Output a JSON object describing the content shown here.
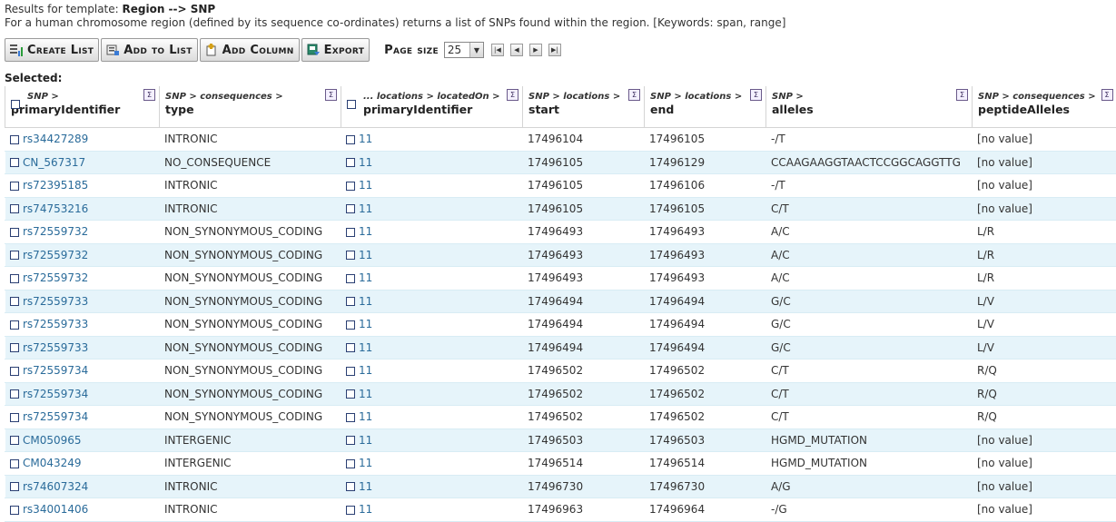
{
  "header": {
    "results_prefix": "Results for template:",
    "template_name": "Region --> SNP",
    "description": "For a human chromosome region (defined by its sequence co-ordinates) returns a list of SNPs found within the region. [Keywords: span, range]"
  },
  "toolbar": {
    "create_list": "Create List",
    "add_to_list": "Add to List",
    "add_column": "Add Column",
    "export": "Export",
    "page_size_label": "Page size",
    "page_size_value": "25"
  },
  "selected_label": "Selected:",
  "columns": [
    {
      "path": "SNP >",
      "field": "primaryIdentifier"
    },
    {
      "path": "SNP > consequences >",
      "field": "type"
    },
    {
      "path": "... locations > locatedOn >",
      "field": "primaryIdentifier"
    },
    {
      "path": "SNP > locations >",
      "field": "start"
    },
    {
      "path": "SNP > locations >",
      "field": "end"
    },
    {
      "path": "SNP >",
      "field": "alleles"
    },
    {
      "path": "SNP > consequences >",
      "field": "peptideAlleles"
    }
  ],
  "sigma": "Σ",
  "rows": [
    {
      "id": "rs34427289",
      "type": "INTRONIC",
      "chr": "11",
      "start": "17496104",
      "end": "17496105",
      "alleles": "-/T",
      "pep": "[no value]"
    },
    {
      "id": "CN_567317",
      "type": "NO_CONSEQUENCE",
      "chr": "11",
      "start": "17496105",
      "end": "17496129",
      "alleles": "CCAAGAAGGTAACTCCGGCAGGTTG",
      "pep": "[no value]"
    },
    {
      "id": "rs72395185",
      "type": "INTRONIC",
      "chr": "11",
      "start": "17496105",
      "end": "17496106",
      "alleles": "-/T",
      "pep": "[no value]"
    },
    {
      "id": "rs74753216",
      "type": "INTRONIC",
      "chr": "11",
      "start": "17496105",
      "end": "17496105",
      "alleles": "C/T",
      "pep": "[no value]"
    },
    {
      "id": "rs72559732",
      "type": "NON_SYNONYMOUS_CODING",
      "chr": "11",
      "start": "17496493",
      "end": "17496493",
      "alleles": "A/C",
      "pep": "L/R"
    },
    {
      "id": "rs72559732",
      "type": "NON_SYNONYMOUS_CODING",
      "chr": "11",
      "start": "17496493",
      "end": "17496493",
      "alleles": "A/C",
      "pep": "L/R"
    },
    {
      "id": "rs72559732",
      "type": "NON_SYNONYMOUS_CODING",
      "chr": "11",
      "start": "17496493",
      "end": "17496493",
      "alleles": "A/C",
      "pep": "L/R"
    },
    {
      "id": "rs72559733",
      "type": "NON_SYNONYMOUS_CODING",
      "chr": "11",
      "start": "17496494",
      "end": "17496494",
      "alleles": "G/C",
      "pep": "L/V"
    },
    {
      "id": "rs72559733",
      "type": "NON_SYNONYMOUS_CODING",
      "chr": "11",
      "start": "17496494",
      "end": "17496494",
      "alleles": "G/C",
      "pep": "L/V"
    },
    {
      "id": "rs72559733",
      "type": "NON_SYNONYMOUS_CODING",
      "chr": "11",
      "start": "17496494",
      "end": "17496494",
      "alleles": "G/C",
      "pep": "L/V"
    },
    {
      "id": "rs72559734",
      "type": "NON_SYNONYMOUS_CODING",
      "chr": "11",
      "start": "17496502",
      "end": "17496502",
      "alleles": "C/T",
      "pep": "R/Q"
    },
    {
      "id": "rs72559734",
      "type": "NON_SYNONYMOUS_CODING",
      "chr": "11",
      "start": "17496502",
      "end": "17496502",
      "alleles": "C/T",
      "pep": "R/Q"
    },
    {
      "id": "rs72559734",
      "type": "NON_SYNONYMOUS_CODING",
      "chr": "11",
      "start": "17496502",
      "end": "17496502",
      "alleles": "C/T",
      "pep": "R/Q"
    },
    {
      "id": "CM050965",
      "type": "INTERGENIC",
      "chr": "11",
      "start": "17496503",
      "end": "17496503",
      "alleles": "HGMD_MUTATION",
      "pep": "[no value]"
    },
    {
      "id": "CM043249",
      "type": "INTERGENIC",
      "chr": "11",
      "start": "17496514",
      "end": "17496514",
      "alleles": "HGMD_MUTATION",
      "pep": "[no value]"
    },
    {
      "id": "rs74607324",
      "type": "INTRONIC",
      "chr": "11",
      "start": "17496730",
      "end": "17496730",
      "alleles": "A/G",
      "pep": "[no value]"
    },
    {
      "id": "rs34001406",
      "type": "INTRONIC",
      "chr": "11",
      "start": "17496963",
      "end": "17496964",
      "alleles": "-/G",
      "pep": "[no value]"
    }
  ]
}
